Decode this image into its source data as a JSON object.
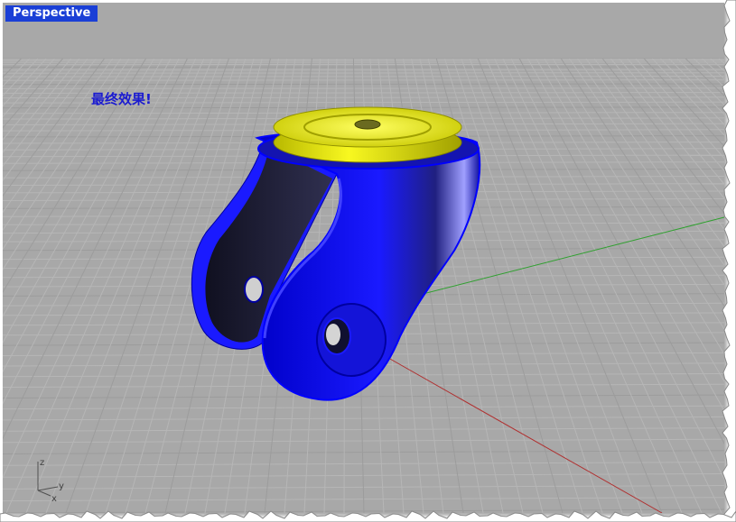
{
  "viewport": {
    "title": "Perspective",
    "annotation": "最终效果!"
  },
  "axes_icon": {
    "z_label": "z",
    "y_label": "y",
    "x_label": "x"
  },
  "colors": {
    "viewport_background": "#a8a8a8",
    "grid_minor": "#b8b8b8",
    "grid_major": "#9a9a9a",
    "x_axis": "#b03030",
    "y_axis": "#2fa02f",
    "model_body": "#1a1aff",
    "model_dark": "#1a1a33",
    "model_cap": "#e8e800",
    "label_tab": "#1a3fd6",
    "annotation_text": "#1b1bd0"
  },
  "icons": {
    "axis_triad": "axis-triad-icon"
  }
}
